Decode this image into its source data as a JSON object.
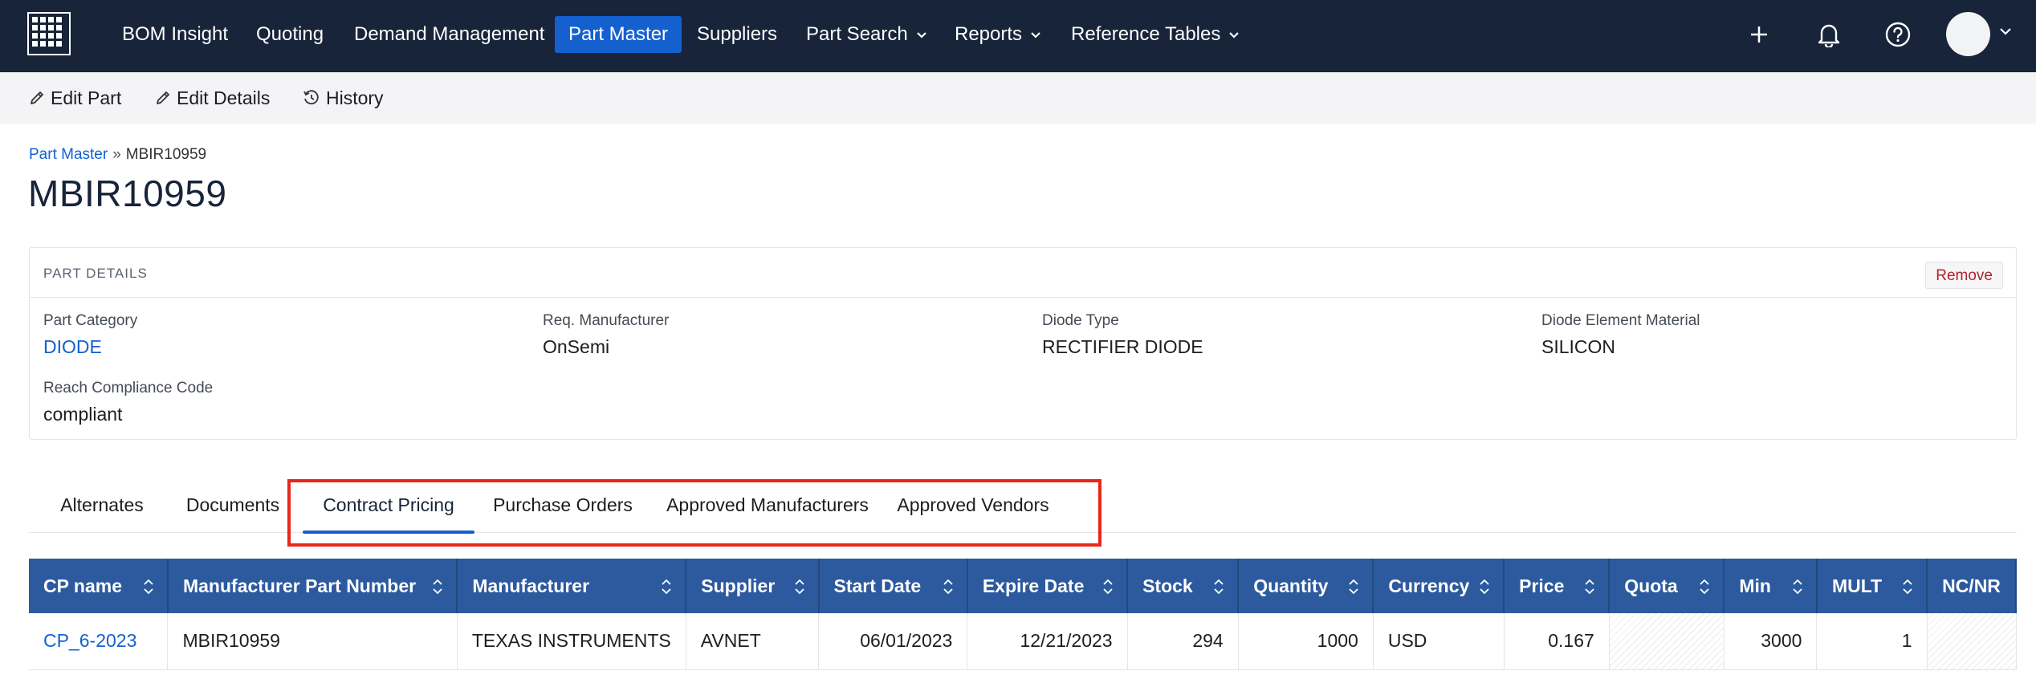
{
  "nav": {
    "items": [
      {
        "label": "BOM Insight"
      },
      {
        "label": "Quoting"
      },
      {
        "label": "Demand Management"
      },
      {
        "label": "Part Master",
        "active": true
      },
      {
        "label": "Suppliers"
      },
      {
        "label": "Part Search",
        "dropdown": true
      },
      {
        "label": "Reports",
        "dropdown": true
      },
      {
        "label": "Reference Tables",
        "dropdown": true
      }
    ],
    "icons": [
      "plus-icon",
      "bell-icon",
      "help-icon"
    ],
    "active_color": "#1460cf",
    "bg_color": "#17243a"
  },
  "toolbar": {
    "edit_part": "Edit Part",
    "edit_details": "Edit Details",
    "history": "History"
  },
  "breadcrumb": {
    "parent": "Part Master",
    "separator": "»",
    "current": "MBIR10959"
  },
  "page_title": "MBIR10959",
  "part_details": {
    "title": "PART DETAILS",
    "remove_label": "Remove",
    "fields": [
      {
        "label": "Part Category",
        "value": "DIODE",
        "link": true
      },
      {
        "label": "Req. Manufacturer",
        "value": "OnSemi"
      },
      {
        "label": "Diode Type",
        "value": "RECTIFIER DIODE"
      },
      {
        "label": "Diode Element Material",
        "value": "SILICON"
      },
      {
        "label": "Reach Compliance Code",
        "value": "compliant"
      }
    ]
  },
  "tabs": [
    {
      "label": "Alternates"
    },
    {
      "label": "Documents"
    },
    {
      "label": "Contract Pricing",
      "active": true
    },
    {
      "label": "Purchase Orders"
    },
    {
      "label": "Approved Manufacturers"
    },
    {
      "label": "Approved Vendors"
    }
  ],
  "table": {
    "columns": [
      "CP name",
      "Manufacturer Part Number",
      "Manufacturer",
      "Supplier",
      "Start Date",
      "Expire Date",
      "Stock",
      "Quantity",
      "Currency",
      "Price",
      "Quota",
      "Min",
      "MULT",
      "NC/NR"
    ],
    "rows": [
      [
        "CP_6-2023",
        "MBIR10959",
        "TEXAS INSTRUMENTS",
        "AVNET",
        "06/01/2023",
        "12/21/2023",
        "294",
        "1000",
        "USD",
        "0.167",
        "",
        "3000",
        "1",
        ""
      ]
    ],
    "header_color": "#2d5a9e"
  },
  "highlight_color": "#e8271a"
}
